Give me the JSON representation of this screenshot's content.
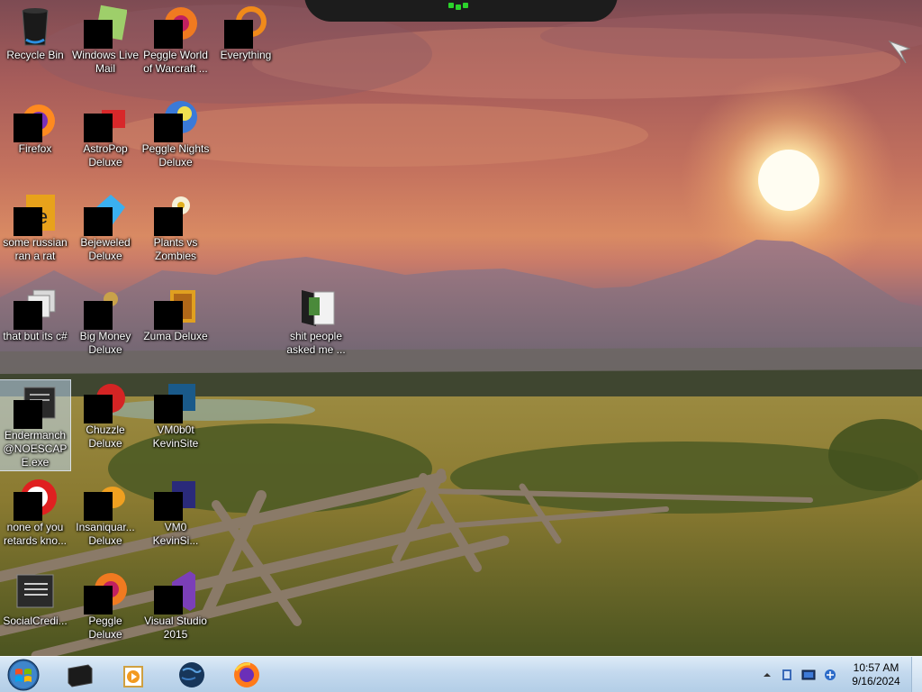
{
  "desktop": {
    "icons": [
      {
        "label": "Recycle Bin",
        "icon": "recycle-bin-icon"
      },
      {
        "label": "Windows Live Mail",
        "icon": "mail-icon"
      },
      {
        "label": "Peggle World of Warcraft ...",
        "icon": "peggle-icon"
      },
      {
        "label": "Everything",
        "icon": "search-app-icon"
      },
      {
        "label": "Firefox",
        "icon": "firefox-icon"
      },
      {
        "label": "AstroPop Deluxe",
        "icon": "game-icon"
      },
      {
        "label": "Peggle Nights Deluxe",
        "icon": "game-icon"
      },
      {
        "label": "some russian ran a rat",
        "icon": "java-file-icon"
      },
      {
        "label": "Bejeweled Deluxe",
        "icon": "gem-icon"
      },
      {
        "label": "Plants vs Zombies",
        "icon": "game-icon"
      },
      {
        "label": "that but its c#",
        "icon": "copy-icon"
      },
      {
        "label": "Big Money Deluxe",
        "icon": "game-icon"
      },
      {
        "label": "Zuma Deluxe",
        "icon": "game-icon"
      },
      {
        "label": "shit people asked me ...",
        "icon": "folder-icon"
      },
      {
        "label": "Endermanch @NOESCAPE.exe",
        "icon": "application-icon"
      },
      {
        "label": "Chuzzle Deluxe",
        "icon": "game-icon"
      },
      {
        "label": "VM0b0t KevinSite",
        "icon": "game-icon"
      },
      {
        "label": "none of you retards kno...",
        "icon": "application-icon"
      },
      {
        "label": "Insaniquar... Deluxe",
        "icon": "game-icon"
      },
      {
        "label": "VM0 KevinSi...",
        "icon": "game-icon"
      },
      {
        "label": "SocialCredi...",
        "icon": "application-icon"
      },
      {
        "label": "Peggle Deluxe",
        "icon": "peggle-icon"
      },
      {
        "label": "Visual Studio 2015",
        "icon": "visual-studio-icon"
      }
    ]
  },
  "taskbar": {
    "start_icon": "windows-start-icon",
    "pinned": [
      {
        "icon": "terminal-icon"
      },
      {
        "icon": "media-player-icon"
      },
      {
        "icon": "globe-icon"
      },
      {
        "icon": "firefox-icon"
      }
    ],
    "tray": {
      "icons": [
        "show-hidden-icons-chevron-icon",
        "flag-icon",
        "display-icon",
        "network-icon"
      ],
      "time": "10:57 AM",
      "date": "9/16/2024"
    }
  }
}
